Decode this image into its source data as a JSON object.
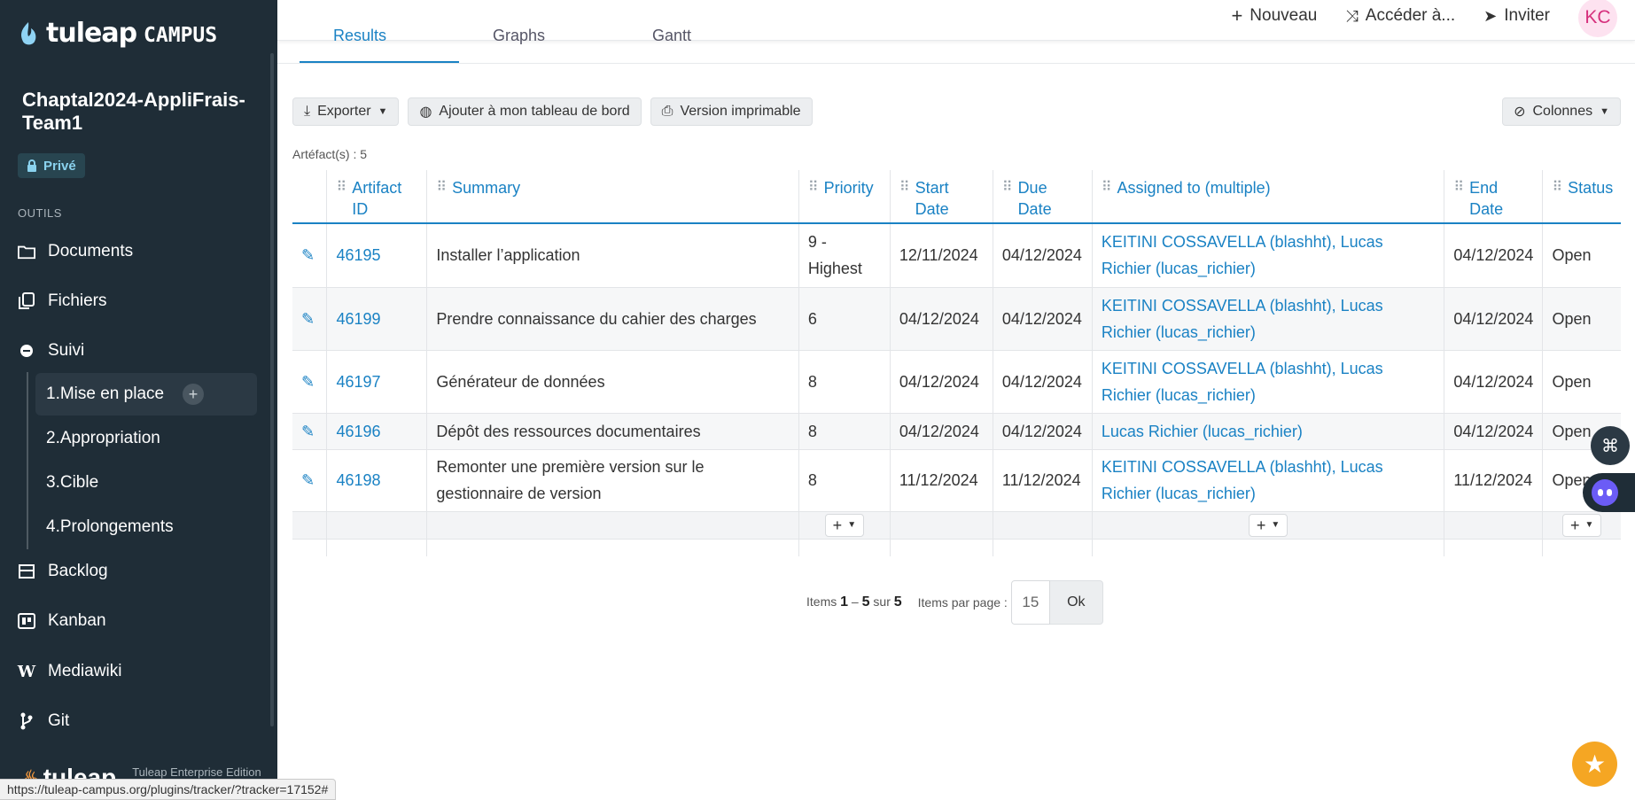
{
  "brand": {
    "name": "tuleap",
    "suffix": "CAMPUS"
  },
  "project": {
    "name": "Chaptal2024-AppliFrais-Team1",
    "privacy": "Privé"
  },
  "sidebar": {
    "section_label": "OUTILS",
    "items": [
      {
        "label": "Documents",
        "icon": "folder-icon"
      },
      {
        "label": "Fichiers",
        "icon": "files-icon"
      },
      {
        "label": "Suivi",
        "icon": "tracker-icon"
      }
    ],
    "trackers": [
      {
        "label": "1.Mise en place",
        "active": true
      },
      {
        "label": "2.Appropriation"
      },
      {
        "label": "3.Cible"
      },
      {
        "label": "4.Prolongements"
      }
    ],
    "items2": [
      {
        "label": "Backlog",
        "icon": "backlog-icon"
      },
      {
        "label": "Kanban",
        "icon": "kanban-icon"
      },
      {
        "label": "Mediawiki",
        "icon": "wiki-icon"
      },
      {
        "label": "Git",
        "icon": "git-branch-icon"
      }
    ],
    "footer": {
      "logo": "tuleap",
      "edition": "Tuleap Enterprise Edition"
    }
  },
  "topbar": {
    "new_label": "Nouveau",
    "access_label": "Accéder à...",
    "invite_label": "Inviter",
    "avatar_initials": "KC"
  },
  "tabs": [
    {
      "label": "Results",
      "active": true
    },
    {
      "label": "Graphs"
    },
    {
      "label": "Gantt"
    }
  ],
  "toolbar": {
    "export_label": "Exporter",
    "dashboard_label": "Ajouter à mon tableau de bord",
    "print_label": "Version imprimable",
    "columns_label": "Colonnes"
  },
  "artifact_count_label": "Artéfact(s) : 5",
  "table": {
    "headers": [
      "Artifact ID",
      "Summary",
      "Priority",
      "Start Date",
      "Due Date",
      "Assigned to (multiple)",
      "End Date",
      "Status"
    ],
    "rows": [
      {
        "id": "46195",
        "summary": "Installer l’application",
        "priority": "9 - Highest",
        "start": "12/11/2024",
        "due": "04/12/2024",
        "assigned": "KEITINI COSSAVELLA (blashht), Lucas Richier (lucas_richier)",
        "end": "04/12/2024",
        "status": "Open"
      },
      {
        "id": "46199",
        "summary": "Prendre connaissance du cahier des charges",
        "priority": "6",
        "start": "04/12/2024",
        "due": "04/12/2024",
        "assigned": "KEITINI COSSAVELLA (blashht), Lucas Richier (lucas_richier)",
        "end": "04/12/2024",
        "status": "Open"
      },
      {
        "id": "46197",
        "summary": "Générateur de données",
        "priority": "8",
        "start": "04/12/2024",
        "due": "04/12/2024",
        "assigned": "KEITINI COSSAVELLA (blashht), Lucas Richier (lucas_richier)",
        "end": "04/12/2024",
        "status": "Open"
      },
      {
        "id": "46196",
        "summary": "Dépôt des ressources documentaires",
        "priority": "8",
        "start": "04/12/2024",
        "due": "04/12/2024",
        "assigned": "Lucas Richier (lucas_richier)",
        "end": "04/12/2024",
        "status": "Open"
      },
      {
        "id": "46198",
        "summary": "Remonter une première version sur le gestionnaire de version",
        "priority": "8",
        "start": "11/12/2024",
        "due": "11/12/2024",
        "assigned": "KEITINI COSSAVELLA (blashht), Lucas Richier (lucas_richier)",
        "end": "11/12/2024",
        "status": "Open"
      }
    ]
  },
  "pager": {
    "items_label": "Items",
    "from": "1",
    "to": "5",
    "sur": "sur",
    "total": "5",
    "per_page_label": "Items par page :",
    "per_page_value": "15",
    "ok_label": "Ok"
  },
  "status_url": "https://tuleap-campus.org/plugins/tracker/?tracker=17152#",
  "colors": {
    "sidebar": "#1f2d37",
    "accent": "#1a82c4",
    "star": "#f5a623"
  }
}
